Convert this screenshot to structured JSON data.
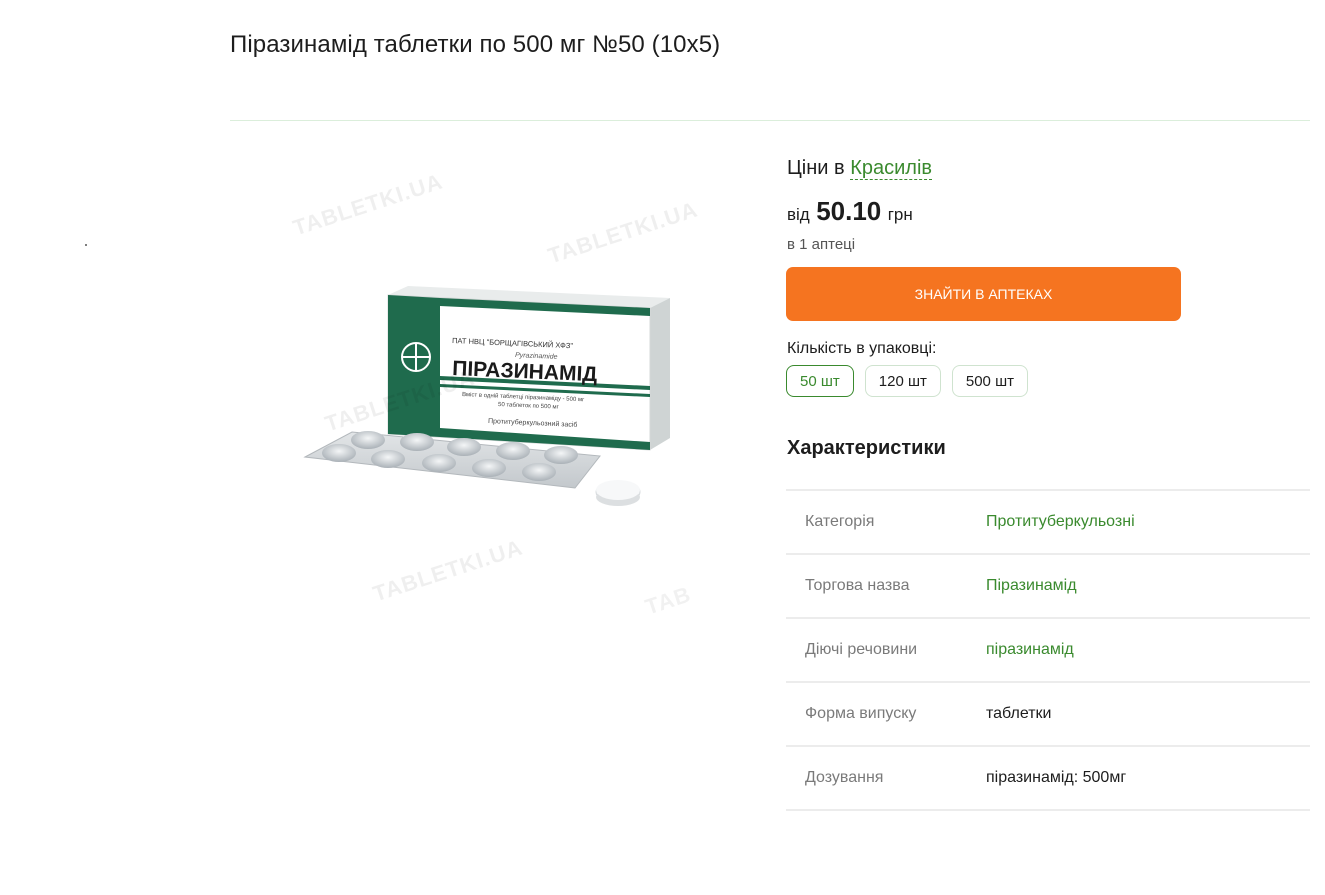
{
  "page": {
    "title": "Піразинамід таблетки по 500 мг №50 (10х5)"
  },
  "image": {
    "watermark": "TABLETKI.UA",
    "box": {
      "manufacturer": "ПАТ НВЦ \"БОРЩАГІВСЬКИЙ ХФЗ\"",
      "latin_name": "Pyrazinamide",
      "brand": "ПІРАЗИНАМІД",
      "composition": "Вміст в одній таблетці піразинаміду - 500 мг",
      "count": "50 таблеток по 500 мг",
      "purpose": "Протитуберкульозний засіб"
    }
  },
  "pricing": {
    "prices_in": "Ціни в",
    "city": "Красилів",
    "from": "від",
    "price": "50.10",
    "currency": "грн",
    "availability": "в 1 аптеці",
    "find_button": "ЗНАЙТИ В АПТЕКАХ"
  },
  "package": {
    "label": "Кількість в упаковці:",
    "options": [
      "50 шт",
      "120 шт",
      "500 шт"
    ],
    "selected": "50 шт"
  },
  "characteristics": {
    "heading": "Характеристики",
    "rows": [
      {
        "key": "Категорія",
        "value": "Протитуберкульозні"
      },
      {
        "key": "Торгова назва",
        "value": "Піразинамід"
      },
      {
        "key": "Діючі речовини",
        "value": "піразинамід"
      },
      {
        "key": "Форма випуску",
        "value": "таблетки"
      },
      {
        "key": "Дозування",
        "value": "піразинамід: 500мг"
      }
    ]
  },
  "colors": {
    "accent_green": "#3a8a2e",
    "button_orange": "#f57420",
    "box_green": "#1f6b4d"
  }
}
